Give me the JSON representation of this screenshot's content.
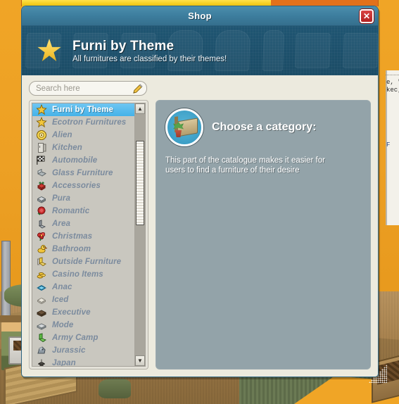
{
  "window": {
    "title": "Shop",
    "close_label": "✕"
  },
  "progress": {
    "percent": 70
  },
  "banner": {
    "icon": "star-icon",
    "title": "Furni by Theme",
    "subtitle": "All furnitures are classified by their themes!"
  },
  "search": {
    "placeholder": "Search here",
    "value": "",
    "icon": "pencil-icon"
  },
  "categories": {
    "partial_top_label": "",
    "items": [
      {
        "label": "Furni by Theme",
        "icon": "star-icon",
        "selected": true
      },
      {
        "label": "Ecotron Furnitures",
        "icon": "star-icon",
        "selected": false
      },
      {
        "label": "Alien",
        "icon": "alien-disc-icon",
        "selected": false
      },
      {
        "label": "Kitchen",
        "icon": "fridge-icon",
        "selected": false
      },
      {
        "label": "Automobile",
        "icon": "checkered-flag-icon",
        "selected": false
      },
      {
        "label": "Glass Furniture",
        "icon": "glass-chair-icon",
        "selected": false
      },
      {
        "label": "Accessories",
        "icon": "red-box-icon",
        "selected": false
      },
      {
        "label": "Pura",
        "icon": "grey-crate-icon",
        "selected": false
      },
      {
        "label": "Romantic",
        "icon": "red-rose-icon",
        "selected": false
      },
      {
        "label": "Area",
        "icon": "grey-chair-icon",
        "selected": false
      },
      {
        "label": "Christmas",
        "icon": "poinsettia-icon",
        "selected": false
      },
      {
        "label": "Bathroom",
        "icon": "rubber-duck-icon",
        "selected": false
      },
      {
        "label": "Outside Furniture",
        "icon": "yellow-chair-icon",
        "selected": false
      },
      {
        "label": "Casino Items",
        "icon": "gold-coins-icon",
        "selected": false
      },
      {
        "label": "Anac",
        "icon": "blue-rug-icon",
        "selected": false
      },
      {
        "label": "Iced",
        "icon": "ice-block-icon",
        "selected": false
      },
      {
        "label": "Executive",
        "icon": "dark-desk-icon",
        "selected": false
      },
      {
        "label": "Mode",
        "icon": "grey-sofa-icon",
        "selected": false
      },
      {
        "label": "Army Camp",
        "icon": "green-chair-icon",
        "selected": false
      },
      {
        "label": "Jurassic",
        "icon": "dino-rock-icon",
        "selected": false
      },
      {
        "label": "Japan",
        "icon": "japan-lamp-icon",
        "selected": false
      }
    ]
  },
  "scrollbar": {
    "up_arrow": "▲",
    "down_arrow": "▼"
  },
  "detail": {
    "icon": "bed-plant-icon",
    "title": "Choose a category:",
    "description": "This part of the catalogue makes it easier for users to find a furniture of their desire"
  },
  "background": {
    "chat_line": "e, \"Az",
    "chat_line2": "kec, e",
    "chat_line3": "F",
    "tent_marker": "✕"
  },
  "colors": {
    "titlebar": "#3c7c9c",
    "banner": "#1b4c66",
    "window_bg": "#eceade",
    "selection": "#45b2e8",
    "detail_pane": "#93a3a9",
    "list_text": "#7b8b9e",
    "room_orange": "#f0a526",
    "progress_fill": "#f5cf23",
    "close_red": "#b32222"
  }
}
